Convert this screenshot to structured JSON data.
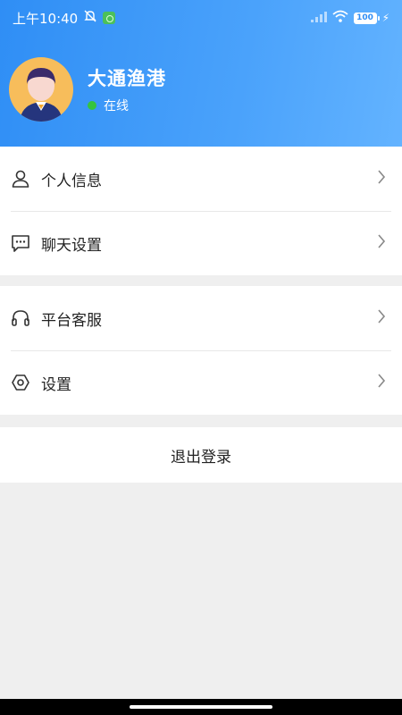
{
  "status_bar": {
    "time": "上午10:40",
    "battery": "100"
  },
  "profile": {
    "name": "大通渔港",
    "status": "在线",
    "status_color": "#35c43f"
  },
  "menu": {
    "group1": [
      {
        "label": "个人信息",
        "icon": "person-icon"
      },
      {
        "label": "聊天设置",
        "icon": "chat-icon"
      }
    ],
    "group2": [
      {
        "label": "平台客服",
        "icon": "headset-icon"
      },
      {
        "label": "设置",
        "icon": "settings-icon"
      }
    ]
  },
  "logout_label": "退出登录",
  "colors": {
    "header_gradient_start": "#2f8ef5",
    "header_gradient_end": "#63b3ff",
    "background": "#efefef"
  }
}
